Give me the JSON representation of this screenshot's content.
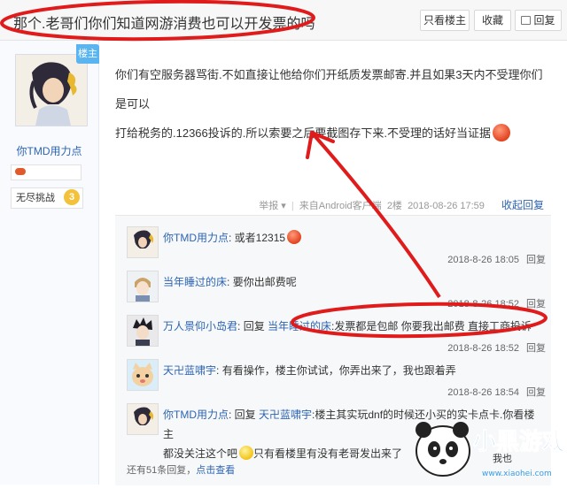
{
  "header": {
    "title": "那个.老哥们你们知道网游消费也可以开发票的吗",
    "btn_louzhu": "只看楼主",
    "btn_favorite": "收藏",
    "btn_reply": "回复"
  },
  "author": {
    "badge_louzhu": "楼主",
    "name": "你TMD用力点",
    "honor_label": "无尽挑战",
    "honor_level": "3"
  },
  "post": {
    "content_line1": "你们有空服务器骂街.不如直接让他给你们开纸质发票邮寄.并且如果3天内不受理你们是可以",
    "content_line2": "打给税务的.12366投诉的.所以索要之后要截图存下来.不受理的话好当证据",
    "meta_report": "举报",
    "meta_source": "来自Android客户端",
    "meta_floor": "2楼",
    "meta_time": "2018-08-26 17:59",
    "collapse_label": "收起回复"
  },
  "replies": [
    {
      "user": "你TMD用力点",
      "text": "或者12315",
      "time": "2018-8-26 18:05",
      "reply_label": "回复"
    },
    {
      "user": "当年睡过的床",
      "text": "要你出邮费呢",
      "time": "2018-8-26 18:52",
      "reply_label": "回复"
    },
    {
      "user": "万人景仰小岛君",
      "pre": "回复 ",
      "target": "当年睡过的床",
      "text": ":发票都是包邮 你要我出邮费 直接工商投诉",
      "time": "2018-8-26 18:52",
      "reply_label": "回复"
    },
    {
      "user": "天卍蓝啸宇",
      "text": "有看操作，楼主你试试，你弄出来了，我也跟着弄",
      "time": "2018-8-26 18:54",
      "reply_label": "回复"
    },
    {
      "user": "你TMD用力点",
      "pre": "回复 ",
      "target": "天卍蓝啸宇",
      "text": ":楼主其实玩dnf的时候还小买的实卡点卡.你看楼主",
      "text2": "都没关注这个吧",
      "text3": "只有看楼里有没有老哥发出来了",
      "time": "",
      "reply_label": ""
    }
  ],
  "more": {
    "prefix": "还有51条回复，",
    "link": "点击查看"
  },
  "watermark": {
    "brand": "小黑游戏",
    "url": "www.xiaohei.com",
    "partial": "我也"
  },
  "colors": {
    "link": "#2d64b3",
    "annotation": "#e01b1b"
  }
}
